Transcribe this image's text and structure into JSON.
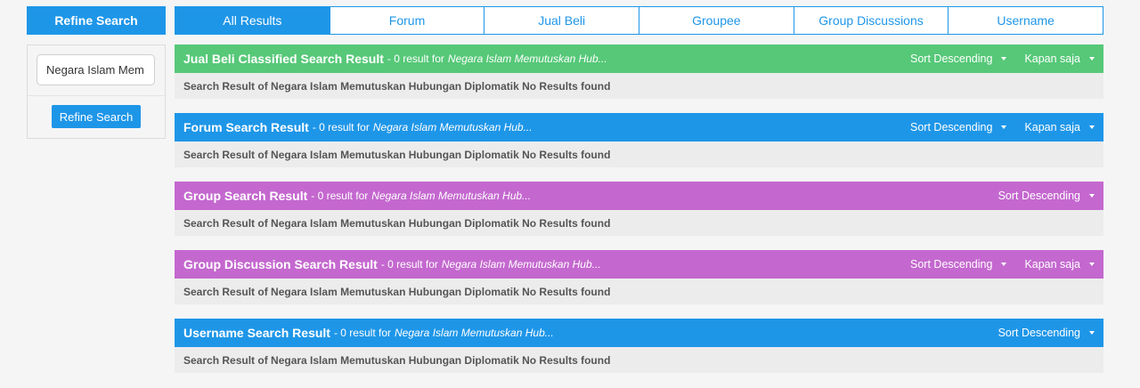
{
  "sidebar": {
    "header": "Refine Search",
    "input_value": "Negara Islam Mem",
    "button_label": "Refine Search"
  },
  "tabs": [
    {
      "label": "All Results",
      "active": true
    },
    {
      "label": "Forum",
      "active": false
    },
    {
      "label": "Jual Beli",
      "active": false
    },
    {
      "label": "Groupee",
      "active": false
    },
    {
      "label": "Group Discussions",
      "active": false
    },
    {
      "label": "Username",
      "active": false
    }
  ],
  "colors": {
    "accent": "#1e96e8",
    "jual_beli": "#56c878",
    "forum": "#1e96e8",
    "group": "#c468cf",
    "username": "#1e96e8"
  },
  "sections": [
    {
      "title": "Jual Beli Classified Search Result",
      "count": "- 0 result for",
      "query": "Negara Islam Memutuskan Hub...",
      "sort": "Sort Descending",
      "time": "Kapan saja",
      "color": "#56c878",
      "body": "Search Result of Negara Islam Memutuskan Hubungan Diplomatik No Results found"
    },
    {
      "title": "Forum Search Result",
      "count": "- 0 result for",
      "query": "Negara Islam Memutuskan Hub...",
      "sort": "Sort Descending",
      "time": "Kapan saja",
      "color": "#1e96e8",
      "body": "Search Result of Negara Islam Memutuskan Hubungan Diplomatik No Results found"
    },
    {
      "title": "Group Search Result",
      "count": "- 0 result for",
      "query": "Negara Islam Memutuskan Hub...",
      "sort": "Sort Descending",
      "time": null,
      "color": "#c468cf",
      "body": "Search Result of Negara Islam Memutuskan Hubungan Diplomatik No Results found"
    },
    {
      "title": "Group Discussion Search Result",
      "count": "- 0 result for",
      "query": "Negara Islam Memutuskan Hub...",
      "sort": "Sort Descending",
      "time": "Kapan saja",
      "color": "#c468cf",
      "body": "Search Result of Negara Islam Memutuskan Hubungan Diplomatik No Results found"
    },
    {
      "title": "Username Search Result",
      "count": "- 0 result for",
      "query": "Negara Islam Memutuskan Hub...",
      "sort": "Sort Descending",
      "time": null,
      "color": "#1e96e8",
      "body": "Search Result of Negara Islam Memutuskan Hubungan Diplomatik No Results found"
    }
  ]
}
